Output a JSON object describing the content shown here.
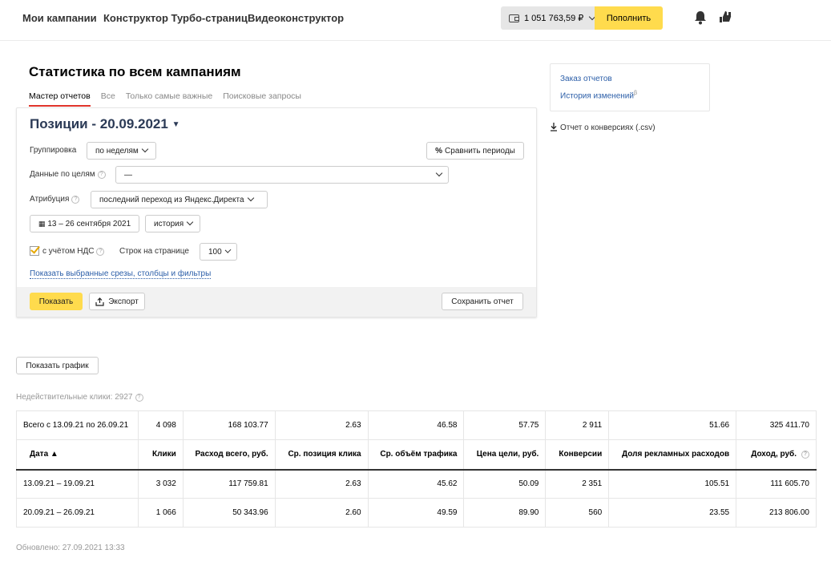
{
  "nav": {
    "items": [
      "Мои кампании",
      "Конструктор Турбо-страниц",
      "Видеоконструктор"
    ],
    "balance": "1 051 763,59 ₽",
    "topup_label": "Пополнить"
  },
  "page": {
    "title": "Статистика по всем кампаниям",
    "tabs": [
      "Мастер отчетов",
      "Все",
      "Только самые важные",
      "Поисковые запросы"
    ]
  },
  "form": {
    "report_title": "Позиции - 20.09.2021",
    "grouping_label": "Группировка",
    "grouping_value": "по неделям",
    "compare_label": "Сравнить периоды",
    "goals_label": "Данные по целям",
    "goals_value": "—",
    "attribution_label": "Атрибуция",
    "attribution_value": "последний переход из Яндекс.Директа",
    "date_range": "13 – 26 сентября 2021",
    "history_value": "история",
    "vat_label": "с учётом НДС",
    "rows_label": "Строк на странице",
    "rows_value": "100",
    "show_filters_link": "Показать выбранные срезы, столбцы и фильтры",
    "show_button": "Показать",
    "export_button": "Экспорт",
    "save_button": "Сохранить отчет"
  },
  "side": {
    "order_reports": "Заказ отчетов",
    "history": "История изменений",
    "beta": "β",
    "csv": "Отчет о конверсиях (.csv)"
  },
  "show_chart_button": "Показать график",
  "invalid_clicks": "Недействительные клики: 2927",
  "updated": "Обновлено: 27.09.2021 13:33",
  "table": {
    "total": [
      "Всего с 13.09.21 по 26.09.21",
      "4 098",
      "168 103.77",
      "2.63",
      "46.58",
      "57.75",
      "2 911",
      "51.66",
      "325 411.70"
    ],
    "headers": [
      "Дата ▲",
      "Клики",
      "Расход всего, руб.",
      "Ср. позиция клика",
      "Ср. объём трафика",
      "Цена цели, руб.",
      "Конверсии",
      "Доля рекламных расходов",
      "Доход, руб."
    ],
    "rows": [
      [
        "13.09.21 – 19.09.21",
        "3 032",
        "117 759.81",
        "2.63",
        "45.62",
        "50.09",
        "2 351",
        "105.51",
        "111 605.70"
      ],
      [
        "20.09.21 – 26.09.21",
        "1 066",
        "50 343.96",
        "2.60",
        "49.59",
        "89.90",
        "560",
        "23.55",
        "213 806.00"
      ]
    ]
  },
  "colors": {
    "accent": "#ffdb4d",
    "tab_active": "#e0342b",
    "link": "#2b5ea8"
  }
}
